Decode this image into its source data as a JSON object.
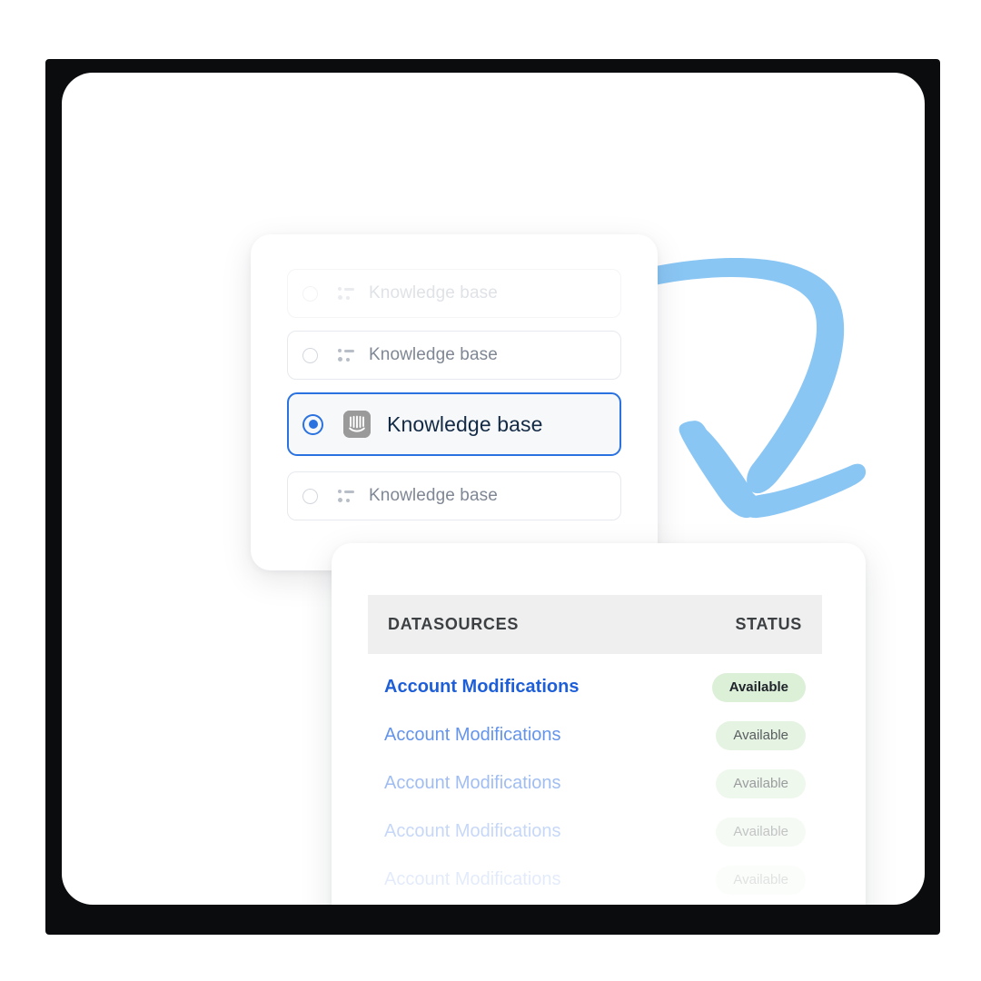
{
  "theme": {
    "accent_blue": "#2a72e0",
    "link_blue": "#2f6fe4",
    "arrow_blue": "#8ac6f4",
    "badge_green_bg": "#dcf0d8",
    "header_gray_bg": "#efefef",
    "backdrop": "#0b0c0d",
    "card_bg": "#ffffff"
  },
  "arrow": {
    "name": "curved-down-arrow",
    "color": "#8ac6f4"
  },
  "source_picker": {
    "options": [
      {
        "label": "Knowledge base",
        "icon": "datasource-list-icon",
        "selected": false,
        "state": "faded"
      },
      {
        "label": "Knowledge base",
        "icon": "datasource-list-icon",
        "selected": false,
        "state": "normal"
      },
      {
        "label": "Knowledge base",
        "icon": "intercom-app-icon",
        "selected": true,
        "state": "selected"
      },
      {
        "label": "Knowledge base",
        "icon": "datasource-list-icon",
        "selected": false,
        "state": "normal"
      }
    ]
  },
  "datasources_table": {
    "columns": {
      "name": "DATASOURCES",
      "status": "STATUS"
    },
    "rows": [
      {
        "name": "Account Modifications",
        "status": "Available"
      },
      {
        "name": "Account Modifications",
        "status": "Available"
      },
      {
        "name": "Account Modifications",
        "status": "Available"
      },
      {
        "name": "Account Modifications",
        "status": "Available"
      },
      {
        "name": "Account Modifications",
        "status": "Available"
      }
    ]
  }
}
